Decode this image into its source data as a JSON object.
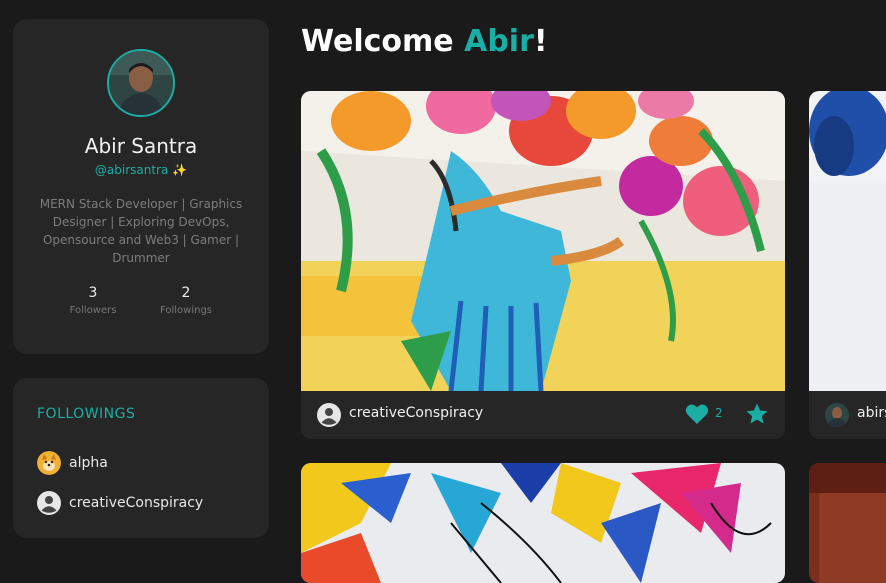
{
  "profile": {
    "name": "Abir Santra",
    "handle": "@abirsantra ✨",
    "bio": "MERN Stack Developer | Graphics Designer | Exploring DevOps, Opensource and Web3 | Gamer | Drummer",
    "followers_count": "3",
    "followers_label": "Followers",
    "followings_count": "2",
    "followings_label": "Followings"
  },
  "followings": {
    "title": "FOLLOWINGS",
    "items": [
      {
        "label": "alpha",
        "icon": "shiba-avatar"
      },
      {
        "label": "creativeConspiracy",
        "icon": "default-user-icon"
      }
    ]
  },
  "welcome": {
    "prefix": "Welcome ",
    "name": "Abir",
    "suffix": "!"
  },
  "posts": [
    {
      "user": "creativeConspiracy",
      "likes": "2",
      "image": "painting-girl-with-flowers"
    },
    {
      "user": "abirsantra",
      "image": "blue-cloth-photo"
    },
    {
      "image": "abstract-paint-splashes"
    },
    {
      "image": "red-wooden-photo"
    }
  ],
  "colors": {
    "accent": "#1aaea5",
    "background": "#1a1a1a",
    "card": "#262626"
  }
}
